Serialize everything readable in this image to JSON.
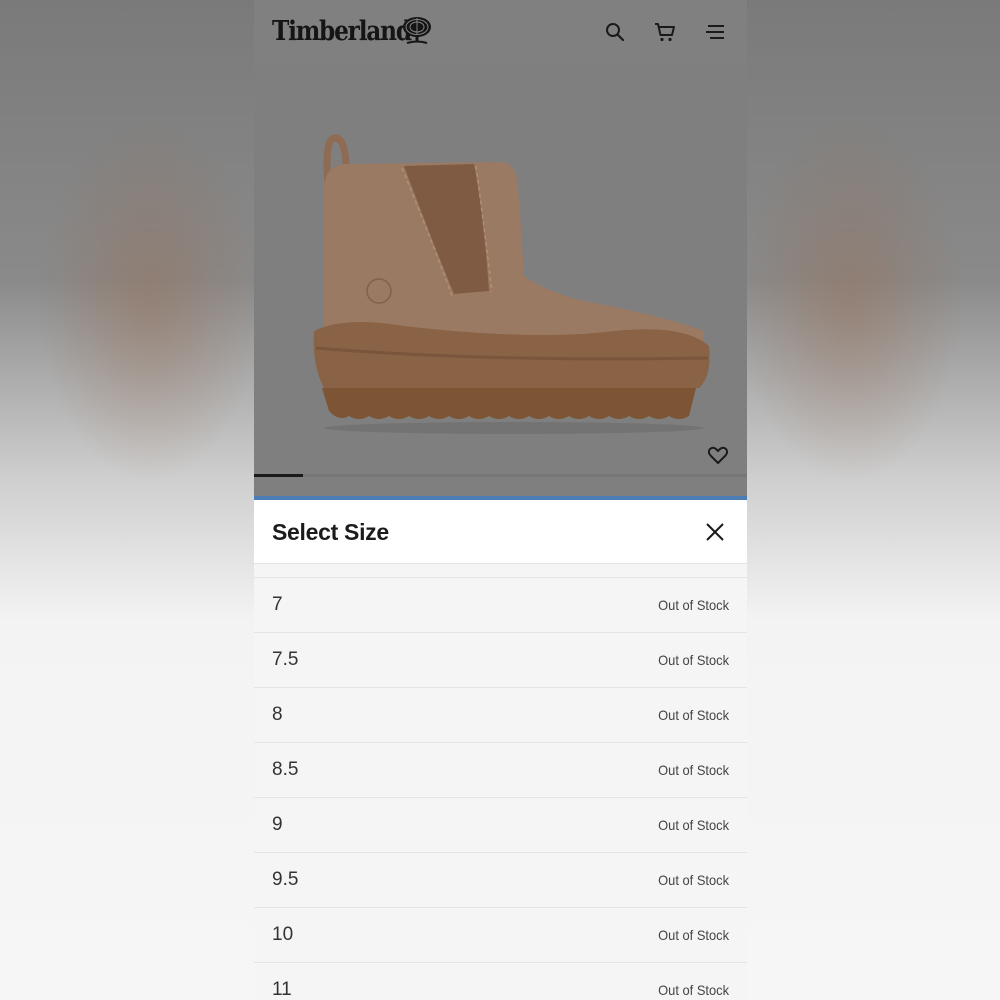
{
  "header": {
    "brand": "Timberland",
    "icons": [
      "search-icon",
      "cart-icon",
      "menu-icon"
    ]
  },
  "product": {
    "wishlist_icon": "heart-icon",
    "carousel": {
      "current": 1
    }
  },
  "size_sheet": {
    "title": "Select Size",
    "close_icon": "close-icon",
    "sizes": [
      {
        "size": "7",
        "status": "Out of Stock"
      },
      {
        "size": "7.5",
        "status": "Out of Stock"
      },
      {
        "size": "8",
        "status": "Out of Stock"
      },
      {
        "size": "8.5",
        "status": "Out of Stock"
      },
      {
        "size": "9",
        "status": "Out of Stock"
      },
      {
        "size": "9.5",
        "status": "Out of Stock"
      },
      {
        "size": "10",
        "status": "Out of Stock"
      },
      {
        "size": "11",
        "status": "Out of Stock"
      }
    ]
  },
  "colors": {
    "accent": "#4a7eb5",
    "overlay": "#808080",
    "text_primary": "#1b1b1b",
    "boot_tan": "#9a7458"
  }
}
